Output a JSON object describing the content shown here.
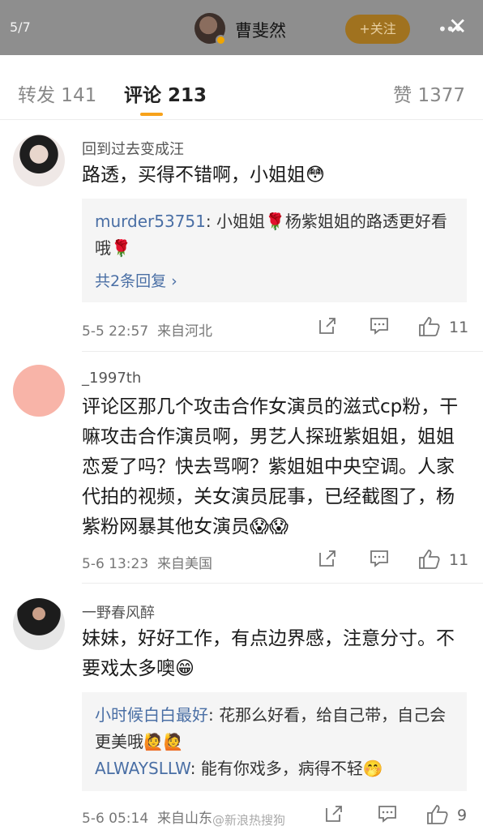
{
  "topbar": {
    "counter": "5/7",
    "name": "曹斐然",
    "follow_label": "+关注",
    "more_label": "•••",
    "close_label": "✕"
  },
  "tabs": {
    "repost": "转发 141",
    "comments": "评论 213",
    "likes": "赞 1377"
  },
  "comments": [
    {
      "user": "回到过去变成汪",
      "text": "路透，买得不错啊，小姐姐😳",
      "replies": [
        {
          "name": "murder53751",
          "text": ": 小姐姐🌹杨紫姐姐的路透更好看哦🌹"
        }
      ],
      "more_replies": "共2条回复 ›",
      "time": "5-5 22:57",
      "source": "来自河北",
      "likes": "11"
    },
    {
      "user": "_1997th",
      "text": "评论区那几个攻击合作女演员的滋式cp粉，干嘛攻击合作演员啊，男艺人探班紫姐姐，姐姐恋爱了吗？快去骂啊？紫姐姐中央空调。人家代拍的视频，关女演员屁事，已经截图了，杨紫粉网暴其他女演员😱😱",
      "time": "5-6 13:23",
      "source": "来自美国",
      "likes": "11"
    },
    {
      "user": "一野春风醉",
      "text": "妹妹，好好工作，有点边界感，注意分寸。不要戏太多噢😁",
      "replies": [
        {
          "name": "小时候白白最好",
          "text": ": 花那么好看，给自己带，自己会更美哦🙋🙋"
        },
        {
          "name": "ALWAYSLLW",
          "text": ": 能有你戏多，病得不轻🤭"
        }
      ],
      "time": "5-6 05:14",
      "source": "来自山东",
      "likes": "9"
    }
  ],
  "watermark": "@新浪热搜狗"
}
